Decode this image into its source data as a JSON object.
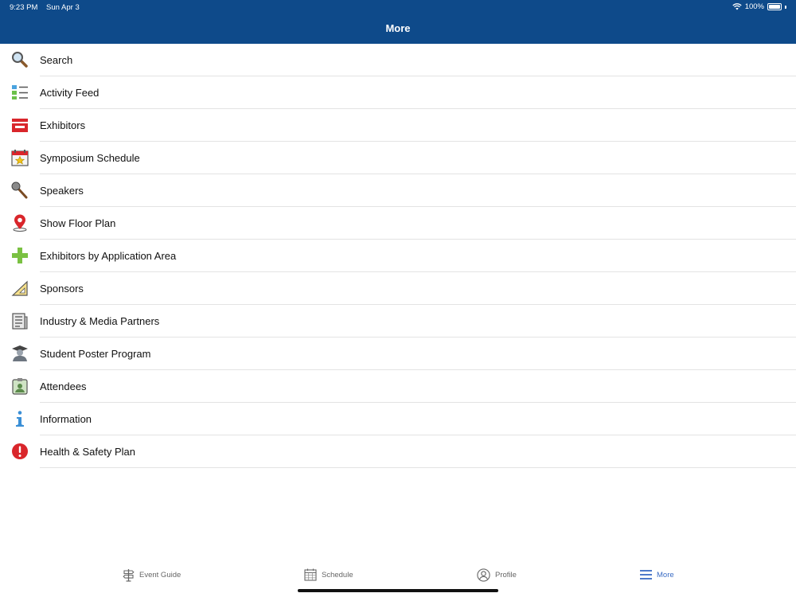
{
  "status": {
    "time": "9:23 PM",
    "date": "Sun Apr 3",
    "battery": "100%"
  },
  "header": {
    "title": "More"
  },
  "menu": {
    "items": [
      {
        "label": "Search",
        "icon": "search-icon"
      },
      {
        "label": "Activity Feed",
        "icon": "activity-feed-icon"
      },
      {
        "label": "Exhibitors",
        "icon": "exhibitors-icon"
      },
      {
        "label": "Symposium Schedule",
        "icon": "calendar-star-icon"
      },
      {
        "label": "Speakers",
        "icon": "microphone-icon"
      },
      {
        "label": "Show Floor Plan",
        "icon": "map-pin-icon"
      },
      {
        "label": "Exhibitors by Application Area",
        "icon": "plus-icon"
      },
      {
        "label": "Sponsors",
        "icon": "ruler-triangle-icon"
      },
      {
        "label": "Industry & Media Partners",
        "icon": "newspaper-icon"
      },
      {
        "label": "Student Poster Program",
        "icon": "graduate-icon"
      },
      {
        "label": "Attendees",
        "icon": "badge-icon"
      },
      {
        "label": "Information",
        "icon": "info-icon"
      },
      {
        "label": "Health & Safety Plan",
        "icon": "alert-icon"
      }
    ]
  },
  "tabs": [
    {
      "label": "Event Guide",
      "icon": "signpost-icon",
      "active": false
    },
    {
      "label": "Schedule",
      "icon": "calendar-icon",
      "active": false
    },
    {
      "label": "Profile",
      "icon": "profile-icon",
      "active": false
    },
    {
      "label": "More",
      "icon": "menu-icon",
      "active": true
    }
  ],
  "colors": {
    "header": "#0e4a8a",
    "active_tab": "#3a6cc4",
    "inactive_tab": "#666666"
  }
}
